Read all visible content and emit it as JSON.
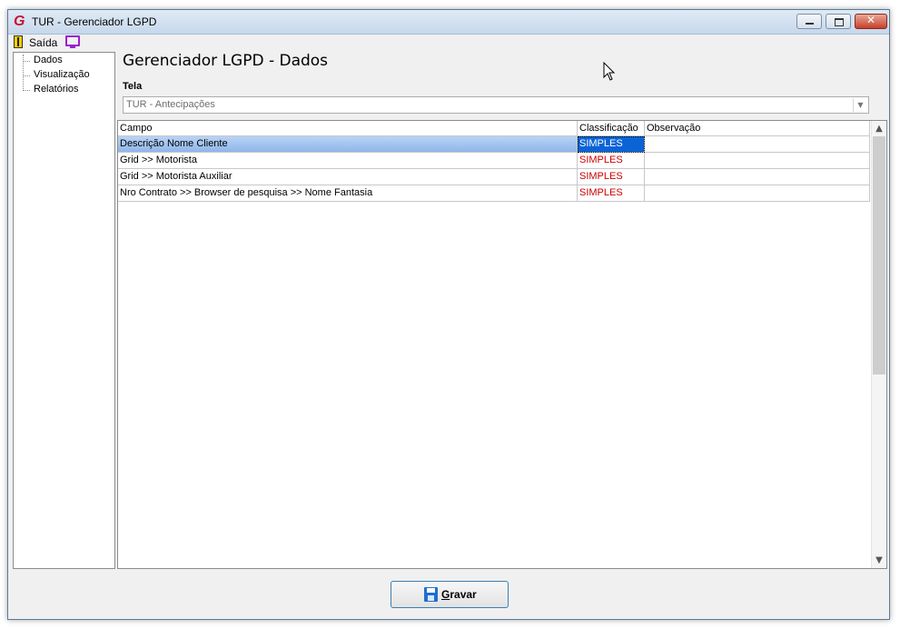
{
  "window": {
    "title": "TUR - Gerenciador LGPD",
    "app_icon": "G",
    "min_glyph": "",
    "close_glyph": "✕"
  },
  "menu": {
    "exit_label": "Saída",
    "exit_icon": "exit-door-icon",
    "screen_icon": "monitor-icon"
  },
  "tree": {
    "items": [
      {
        "label": "Dados"
      },
      {
        "label": "Visualização"
      },
      {
        "label": "Relatórios"
      }
    ]
  },
  "main": {
    "title": "Gerenciador LGPD - Dados",
    "tela_label": "Tela",
    "tela_value": "TUR - Antecipações"
  },
  "grid": {
    "columns": [
      "Campo",
      "Classificação",
      "Observação"
    ],
    "rows": [
      {
        "campo": "Descrição Nome Cliente",
        "classificacao": "SIMPLES",
        "observacao": "",
        "selected": true
      },
      {
        "campo": "Grid >> Motorista",
        "classificacao": "SIMPLES",
        "observacao": ""
      },
      {
        "campo": "Grid >> Motorista Auxiliar",
        "classificacao": "SIMPLES",
        "observacao": ""
      },
      {
        "campo": "Nro Contrato >> Browser de pesquisa >> Nome Fantasia",
        "classificacao": "SIMPLES",
        "observacao": ""
      }
    ]
  },
  "footer": {
    "save_label": "Gravar"
  },
  "colors": {
    "classification_text": "#cc0000",
    "selection": "#0a64d6",
    "window_bg": "#f0f0f0"
  }
}
